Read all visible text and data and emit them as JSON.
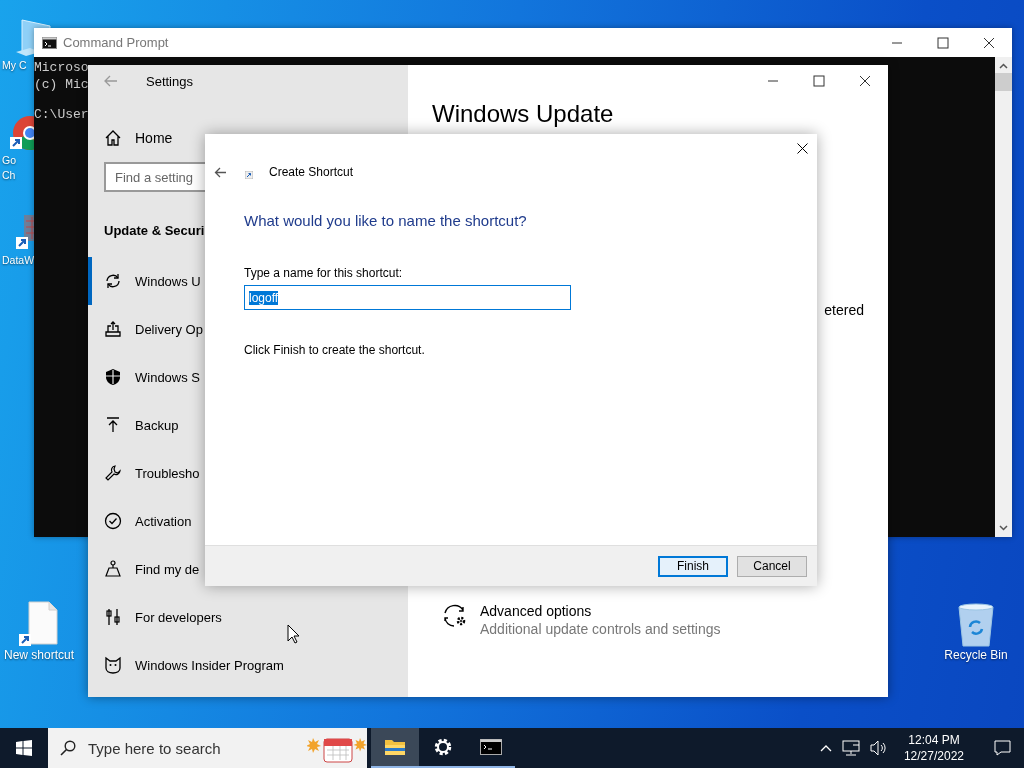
{
  "desktop_icons": [
    {
      "kind": "computer",
      "lines": [
        "My C"
      ]
    },
    {
      "kind": "browser",
      "lines": [
        "Go",
        "Ch"
      ]
    },
    {
      "kind": "data",
      "lines": [
        "DataW"
      ]
    },
    {
      "kind": "file",
      "lines": [
        "New shortcut"
      ]
    },
    {
      "kind": "recycle",
      "lines": [
        "Recycle Bin"
      ]
    }
  ],
  "command_prompt": {
    "title": "Command Prompt",
    "lines": [
      "Microso",
      "(c) Mic",
      "C:\\User"
    ]
  },
  "settings": {
    "title": "Settings",
    "home": "Home",
    "search": {
      "placeholder": "Find a setting"
    },
    "section": "Update & Securi",
    "nav_items": [
      {
        "kind": "sync",
        "label": "Windows U",
        "selected": true
      },
      {
        "kind": "delivery",
        "label": "Delivery Op",
        "selected": false
      },
      {
        "kind": "shield",
        "label": "Windows S",
        "selected": false
      },
      {
        "kind": "backup",
        "label": "Backup",
        "selected": false
      },
      {
        "kind": "wrench",
        "label": "Troublesho",
        "selected": false
      },
      {
        "kind": "check",
        "label": "Activation",
        "selected": false
      },
      {
        "kind": "person",
        "label": "Find my de",
        "selected": false
      },
      {
        "kind": "sliders",
        "label": "For developers",
        "selected": false
      },
      {
        "kind": "cat",
        "label": "Windows Insider Program",
        "selected": false
      }
    ],
    "heading": "Windows Update",
    "status_fragment": "etered",
    "advanced": {
      "title": "Advanced options",
      "subtitle": "Additional update controls and settings"
    }
  },
  "dialog": {
    "title": "Create Shortcut",
    "heading": "What would you like to name the shortcut?",
    "field_label": "Type a name for this shortcut:",
    "field_value": "logoff",
    "value_selected": true,
    "note": "Click Finish to create the shortcut.",
    "buttons": [
      {
        "label": "Finish",
        "default": true
      },
      {
        "label": "Cancel",
        "default": false
      }
    ]
  },
  "taskbar": {
    "search": {
      "placeholder": "Type here to search"
    },
    "apps": [
      {
        "kind": "folder",
        "selected": true,
        "open": true
      },
      {
        "kind": "gear",
        "selected": false,
        "open": true
      },
      {
        "kind": "terminal",
        "selected": false,
        "open": true
      }
    ],
    "time": "12:04 PM",
    "date": "12/27/2022"
  }
}
